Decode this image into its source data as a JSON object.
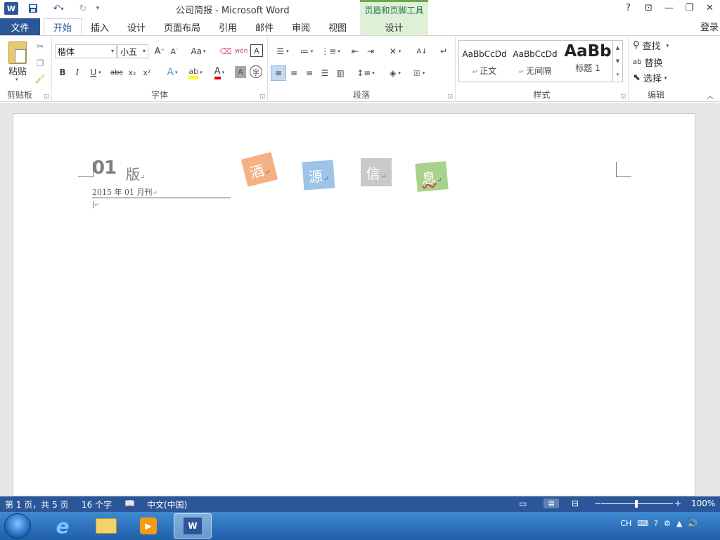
{
  "window": {
    "title": "公司简报 - Microsoft Word",
    "contextual_tool_title": "页眉和页脚工具",
    "controls": {
      "help": "?",
      "ribbon_display": "⊡",
      "minimize": "—",
      "restore": "❐",
      "close": "✕"
    }
  },
  "tabs": {
    "file": "文件",
    "items": [
      {
        "label": "开始",
        "active": true
      },
      {
        "label": "插入",
        "active": false
      },
      {
        "label": "设计",
        "active": false
      },
      {
        "label": "页面布局",
        "active": false
      },
      {
        "label": "引用",
        "active": false
      },
      {
        "label": "邮件",
        "active": false
      },
      {
        "label": "审阅",
        "active": false
      },
      {
        "label": "视图",
        "active": false
      }
    ],
    "contextual_design": "设计",
    "login": "登录"
  },
  "ribbon": {
    "clipboard": {
      "label": "剪贴板",
      "paste": "粘贴"
    },
    "font": {
      "label": "字体",
      "font_name": "楷体",
      "font_size": "小五",
      "bold": "B",
      "italic": "I",
      "underline": "U",
      "strike": "abc",
      "sub": "x₂",
      "sup": "x²",
      "change_case": "Aa",
      "phonetic": "wén",
      "char_border": "A",
      "char_shading": "A",
      "enclose": "字"
    },
    "paragraph": {
      "label": "段落"
    },
    "styles": {
      "label": "样式",
      "items": [
        {
          "sample": "AaBbCcDd",
          "name": "正文"
        },
        {
          "sample": "AaBbCcDd",
          "name": "无间隔"
        },
        {
          "sample": "AaBb",
          "name": "标题 1"
        }
      ]
    },
    "editing": {
      "label": "编辑",
      "find": "查找",
      "replace": "替换",
      "select": "选择"
    }
  },
  "document": {
    "issue_number": "01",
    "issue_suffix": "版",
    "date": "2015 年 01 月刊",
    "paragraph_mark": "↵",
    "tiles": [
      {
        "char": "酒",
        "color": "#f4b183"
      },
      {
        "char": "源",
        "color": "#9dc3e6"
      },
      {
        "char": "信",
        "color": "#c9c9c9"
      },
      {
        "char": "息",
        "color": "#a9d18e"
      }
    ]
  },
  "statusbar": {
    "page": "第 1 页，共 5 页",
    "words": "16 个字",
    "language": "中文(中国)",
    "zoom": "100%",
    "zoom_level": 100
  },
  "taskbar": {
    "tray_lang": "CH"
  }
}
